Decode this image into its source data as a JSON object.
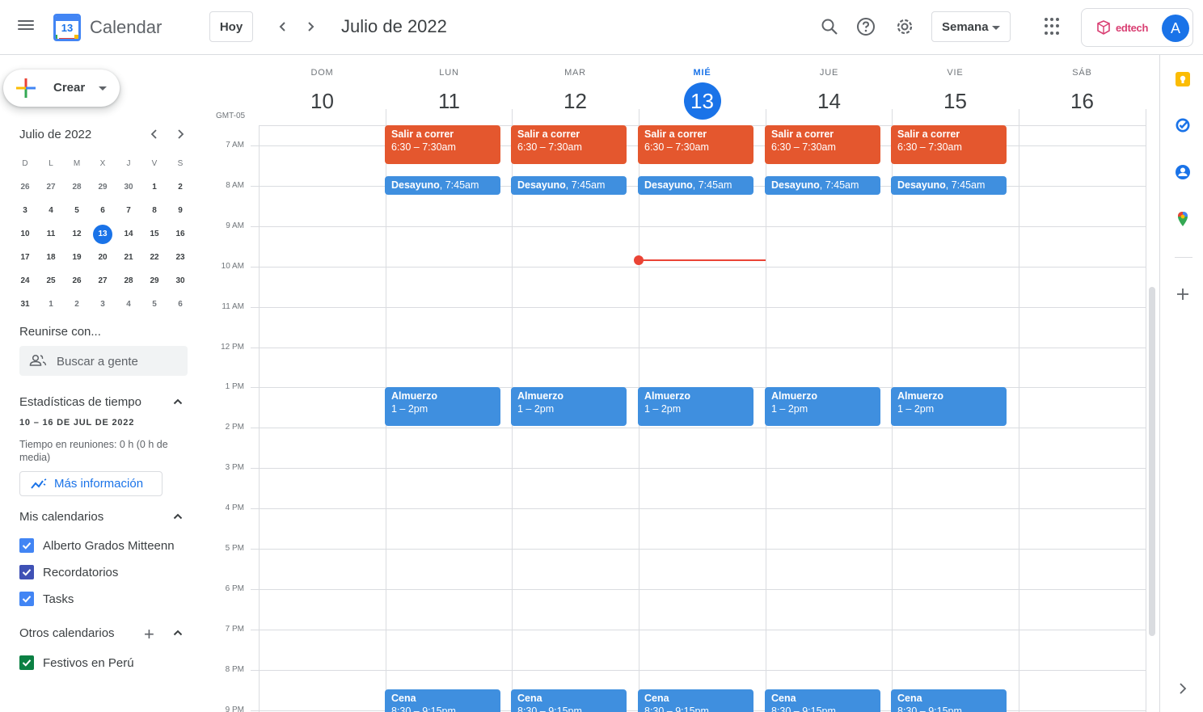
{
  "header": {
    "app_title": "Calendar",
    "logo_day": "13",
    "today_label": "Hoy",
    "month_title": "Julio de 2022",
    "view_label": "Semana",
    "brand_text": "edtech",
    "avatar_initial": "A"
  },
  "sidebar": {
    "create_label": "Crear",
    "mini_calendar": {
      "title": "Julio de 2022",
      "dow": [
        "D",
        "L",
        "M",
        "X",
        "J",
        "V",
        "S"
      ],
      "weeks": [
        [
          "26",
          "27",
          "28",
          "29",
          "30",
          "1",
          "2"
        ],
        [
          "3",
          "4",
          "5",
          "6",
          "7",
          "8",
          "9"
        ],
        [
          "10",
          "11",
          "12",
          "13",
          "14",
          "15",
          "16"
        ],
        [
          "17",
          "18",
          "19",
          "20",
          "21",
          "22",
          "23"
        ],
        [
          "24",
          "25",
          "26",
          "27",
          "28",
          "29",
          "30"
        ],
        [
          "31",
          "1",
          "2",
          "3",
          "4",
          "5",
          "6"
        ]
      ],
      "today": "13"
    },
    "meet_title": "Reunirse con...",
    "search_people_placeholder": "Buscar a gente",
    "stats_title": "Estadísticas de tiempo",
    "date_range": "10 – 16 DE JUL DE 2022",
    "meetings_text": "Tiempo en reuniones: 0 h (0 h de media)",
    "more_info_label": "Más información",
    "my_calendars_title": "Mis calendarios",
    "my_calendars": [
      {
        "label": "Alberto Grados Mitteenn",
        "color": "#4285f4"
      },
      {
        "label": "Recordatorios",
        "color": "#3f51b5"
      },
      {
        "label": "Tasks",
        "color": "#4285f4"
      }
    ],
    "other_calendars_title": "Otros calendarios",
    "other_calendars": [
      {
        "label": "Festivos en Perú",
        "color": "#0b8043"
      }
    ]
  },
  "week": {
    "timezone": "GMT-05",
    "days": [
      {
        "dow": "DOM",
        "num": "10"
      },
      {
        "dow": "LUN",
        "num": "11"
      },
      {
        "dow": "MAR",
        "num": "12"
      },
      {
        "dow": "MIÉ",
        "num": "13",
        "today": true
      },
      {
        "dow": "JUE",
        "num": "14"
      },
      {
        "dow": "VIE",
        "num": "15"
      },
      {
        "dow": "SÁB",
        "num": "16"
      }
    ],
    "hours": [
      "7 AM",
      "8 AM",
      "9 AM",
      "10 AM",
      "11 AM",
      "12 PM",
      "1 PM",
      "2 PM",
      "3 PM",
      "4 PM",
      "5 PM",
      "6 PM",
      "7 PM",
      "8 PM",
      "9 PM"
    ]
  },
  "events": {
    "run": {
      "title": "Salir a correr",
      "time": "6:30 – 7:30am",
      "color": "#e4572e"
    },
    "breakfast": {
      "title": "Desayuno",
      "time": ", 7:45am",
      "color": "#3f8fdf"
    },
    "lunch": {
      "title": "Almuerzo",
      "time": "1 – 2pm",
      "color": "#3f8fdf"
    },
    "dinner": {
      "title": "Cena",
      "time": "8:30 – 9:15pm",
      "color": "#3f8fdf"
    }
  }
}
